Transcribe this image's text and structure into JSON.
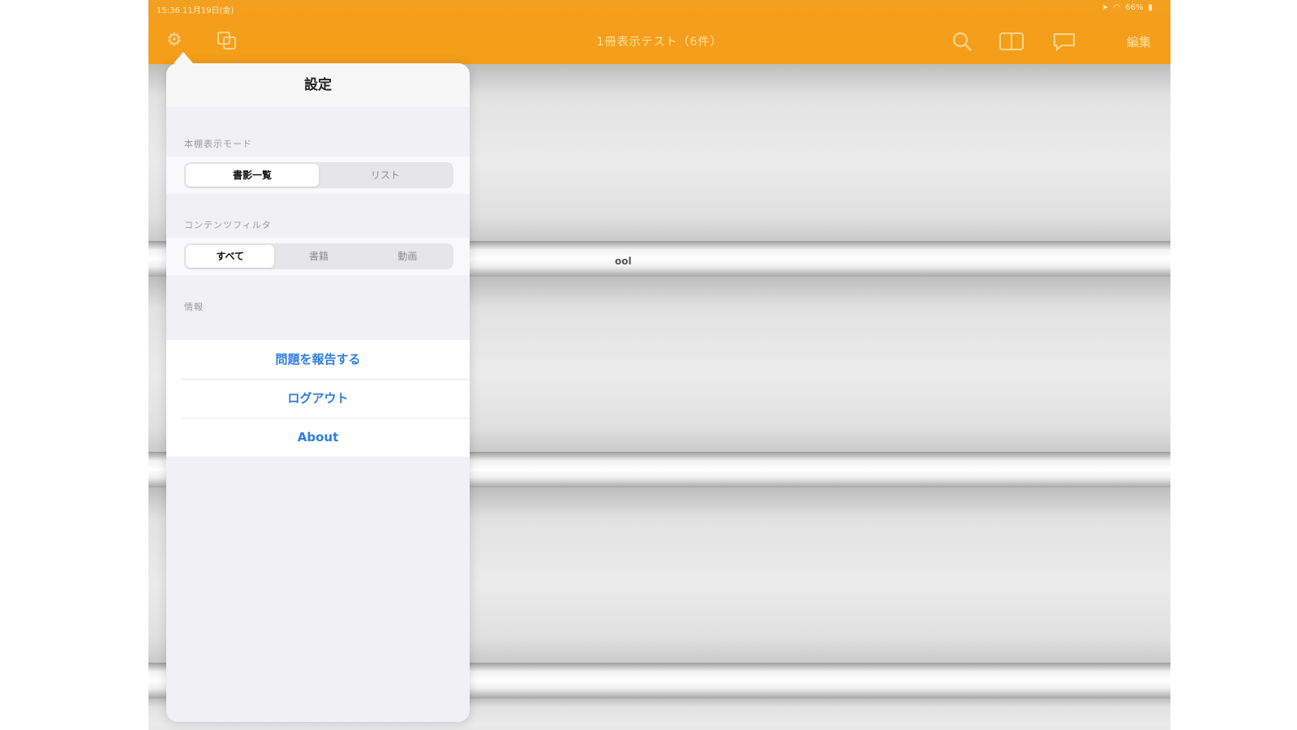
{
  "status_bar": {
    "time": "15:36",
    "date": "11月19日(金)",
    "battery": "66%"
  },
  "nav": {
    "title": "1冊表示テスト（6件）",
    "edit_label": "編集",
    "icons": [
      "gear-icon",
      "copy-icon",
      "search-icon",
      "book-icon",
      "chat-icon"
    ]
  },
  "shelf": {
    "fragment_text": "ool"
  },
  "settings": {
    "title": "設定",
    "display_mode": {
      "label": "本棚表示モード",
      "options": [
        "書影一覧",
        "リスト"
      ],
      "selected": "書影一覧"
    },
    "content_filter": {
      "label": "コンテンツフィルタ",
      "options": [
        "すべて",
        "書籍",
        "動画"
      ],
      "selected": "すべて"
    },
    "info_label": "情報",
    "actions": [
      "問題を報告する",
      "ログアウト",
      "About"
    ]
  },
  "colors": {
    "nav_orange": "#f59d18",
    "link_blue": "#2f7de0"
  }
}
